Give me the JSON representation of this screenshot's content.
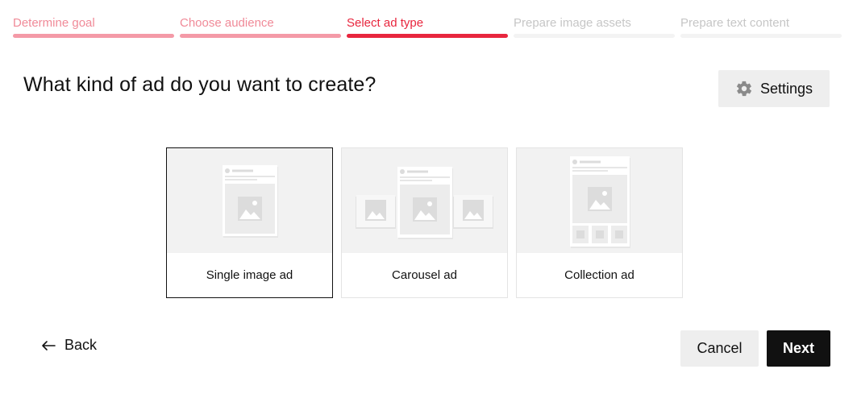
{
  "stepper": {
    "steps": [
      {
        "label": "Determine goal",
        "state": "done"
      },
      {
        "label": "Choose audience",
        "state": "done"
      },
      {
        "label": "Select ad type",
        "state": "current"
      },
      {
        "label": "Prepare image assets",
        "state": "todo"
      },
      {
        "label": "Prepare text content",
        "state": "todo"
      }
    ]
  },
  "header": {
    "title": "What kind of ad do you want to create?",
    "settings_label": "Settings",
    "settings_icon": "gear-icon"
  },
  "ad_types": [
    {
      "label": "Single image ad",
      "selected": true
    },
    {
      "label": "Carousel ad",
      "selected": false
    },
    {
      "label": "Collection ad",
      "selected": false
    }
  ],
  "footer": {
    "back_label": "Back",
    "back_icon": "arrow-left-icon",
    "cancel_label": "Cancel",
    "next_label": "Next"
  },
  "colors": {
    "accent": "#e8263e",
    "accent_done": "#f49aa7",
    "primary_button": "#111111",
    "secondary_button": "#eeeeee"
  }
}
